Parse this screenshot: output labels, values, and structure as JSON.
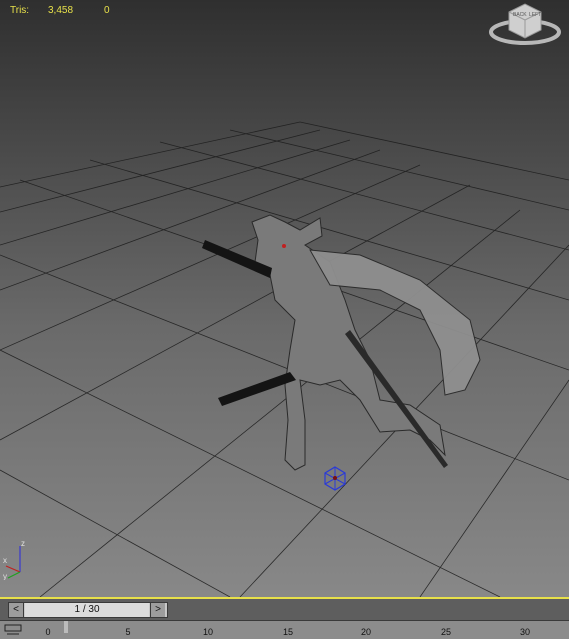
{
  "viewport": {
    "stats": {
      "label": "Tris:",
      "value": "3,458",
      "extra": "0"
    },
    "viewcube": {
      "front_label": "BACK",
      "side_label": "LEFT"
    },
    "axis": {
      "z": "z",
      "x": "x",
      "y": "y"
    },
    "colors": {
      "stats": "#e7e04a",
      "grid": "#1a1a1a",
      "background_top": "#2f2f2f",
      "background_bottom": "#888888"
    }
  },
  "timeline": {
    "prev_label": "<",
    "next_label": ">",
    "frame_display": "1 / 30",
    "ruler_ticks": [
      "0",
      "5",
      "10",
      "15",
      "20",
      "25",
      "30"
    ],
    "accent_color": "#e7e04a"
  }
}
